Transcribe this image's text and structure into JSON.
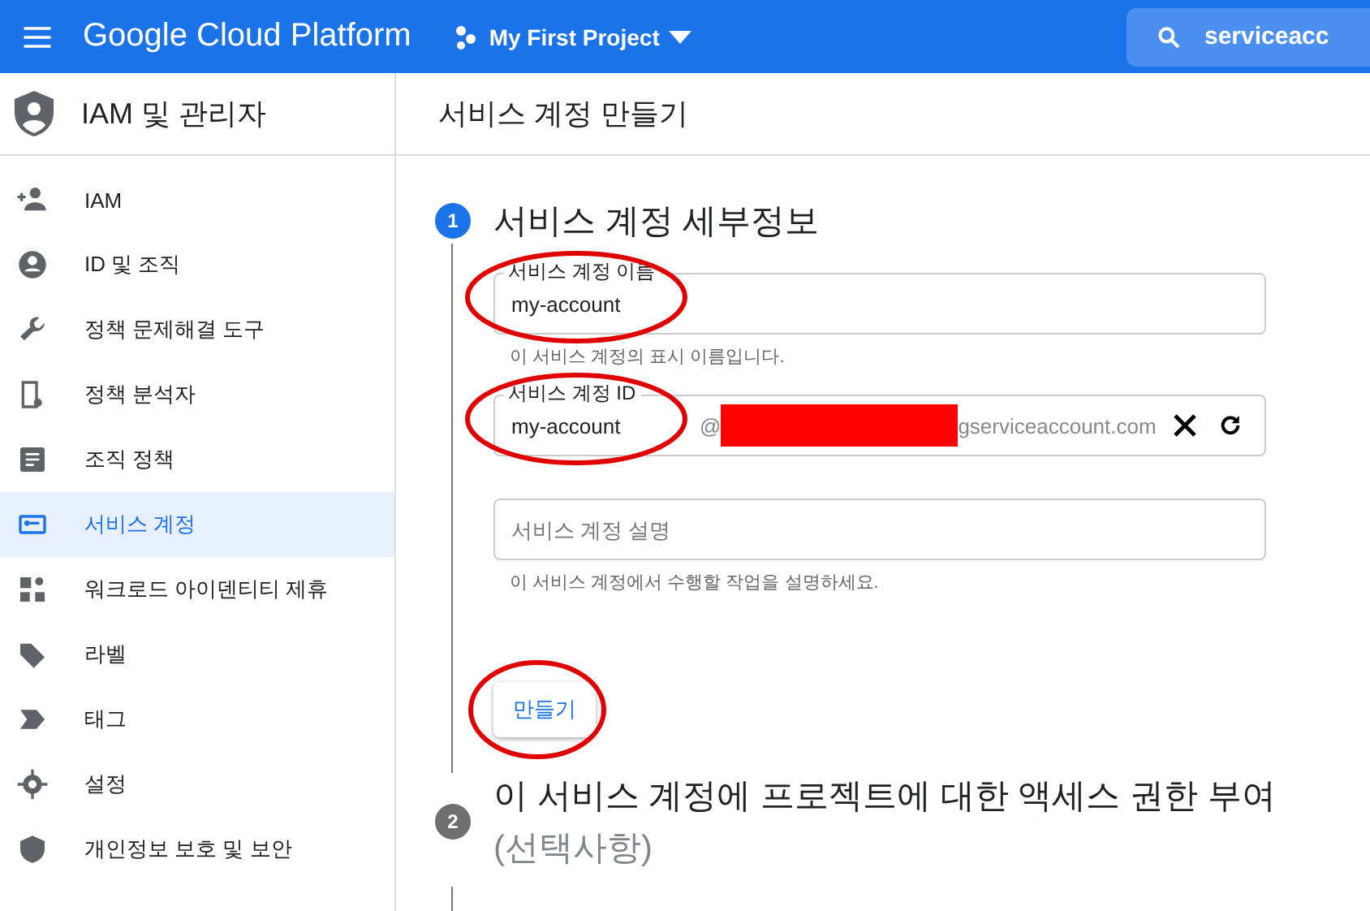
{
  "topbar": {
    "product": "Google Cloud Platform",
    "project": "My First Project",
    "search": {
      "value": "serviceacc"
    }
  },
  "sidebar": {
    "title": "IAM 및 관리자",
    "items": [
      {
        "label": "IAM",
        "selected": false
      },
      {
        "label": "ID 및 조직",
        "selected": false
      },
      {
        "label": "정책 문제해결 도구",
        "selected": false
      },
      {
        "label": "정책 분석자",
        "selected": false
      },
      {
        "label": "조직 정책",
        "selected": false
      },
      {
        "label": "서비스 계정",
        "selected": true
      },
      {
        "label": "워크로드 아이덴티티 제휴",
        "selected": false
      },
      {
        "label": "라벨",
        "selected": false
      },
      {
        "label": "태그",
        "selected": false
      },
      {
        "label": "설정",
        "selected": false
      },
      {
        "label": "개인정보 보호 및 보안",
        "selected": false
      }
    ]
  },
  "page_title": "서비스 계정 만들기",
  "steps": [
    {
      "number": "1",
      "title": "서비스 계정 세부정보",
      "active": true,
      "fields": [
        {
          "label": "서비스 계정 이름",
          "value": "my-account",
          "helper": "이 서비스 계정의 표시 이름입니다.",
          "circled": true
        },
        {
          "label": "서비스 계정 ID",
          "value": "my-account",
          "suffix_start": "@",
          "suffix_end": "gserviceaccount.com",
          "circled": true
        },
        {
          "placeholder": "서비스 계정 설명",
          "helper": "이 서비스 계정에서 수행할 작업을 설명하세요.",
          "circled": false
        }
      ],
      "button": {
        "label": "만들기",
        "circled": true
      }
    },
    {
      "number": "2",
      "title": "이 서비스 계정에 프로젝트에 대한 액세스 권한 부여",
      "note": "(선택사항)",
      "active": false
    }
  ]
}
